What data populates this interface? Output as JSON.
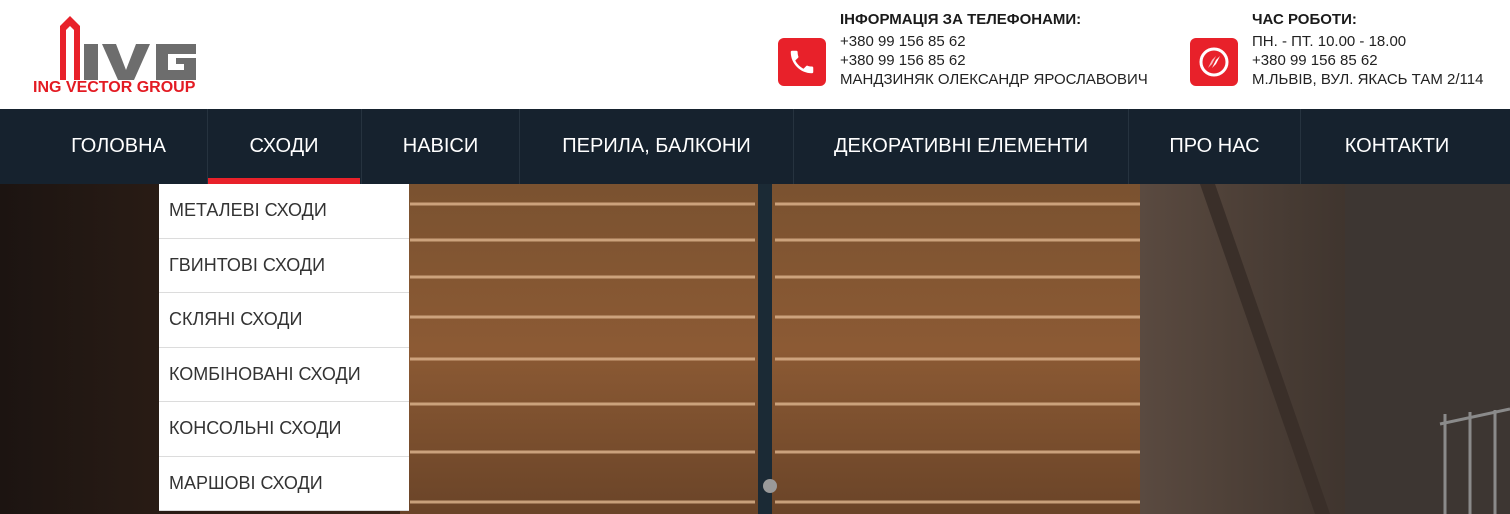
{
  "brand": {
    "logo_text": "ING VECTOR GROUP",
    "mark_letters": "IVG",
    "accent_color": "#e8212a",
    "nav_bg": "#16222e"
  },
  "contacts": {
    "phones": {
      "icon": "phone-icon",
      "title": "ІНФОРМАЦІЯ ЗА ТЕЛЕФОНАМИ:",
      "lines": [
        "+380 99 156 85 62",
        "+380 99 156 85 62",
        "МАНДЗИНЯК ОЛЕКСАНДР ЯРОСЛАВОВИЧ"
      ]
    },
    "hours": {
      "icon": "compass-icon",
      "title": "ЧАС РОБОТИ:",
      "lines": [
        "ПН. - ПТ. 10.00 - 18.00",
        "+380 99 156 85 62",
        "М.ЛЬВІВ, ВУЛ. ЯКАСЬ ТАМ 2/114"
      ]
    }
  },
  "nav": {
    "active": "СХОДИ",
    "items": [
      "ГОЛОВНА",
      "СХОДИ",
      "НАВІСИ",
      "ПЕРИЛА, БАЛКОНИ",
      "ДЕКОРАТИВНІ ЕЛЕМЕНТИ",
      "ПРО НАС",
      "КОНТАКТИ"
    ]
  },
  "dropdown": {
    "items": [
      "МЕТАЛЕВІ СХОДИ",
      "ГВИНТОВІ СХОДИ",
      "СКЛЯНІ СХОДИ",
      "КОМБІНОВАНІ СХОДИ",
      "КОНСОЛЬНІ СХОДИ",
      "МАРШОВІ СХОДИ"
    ]
  }
}
